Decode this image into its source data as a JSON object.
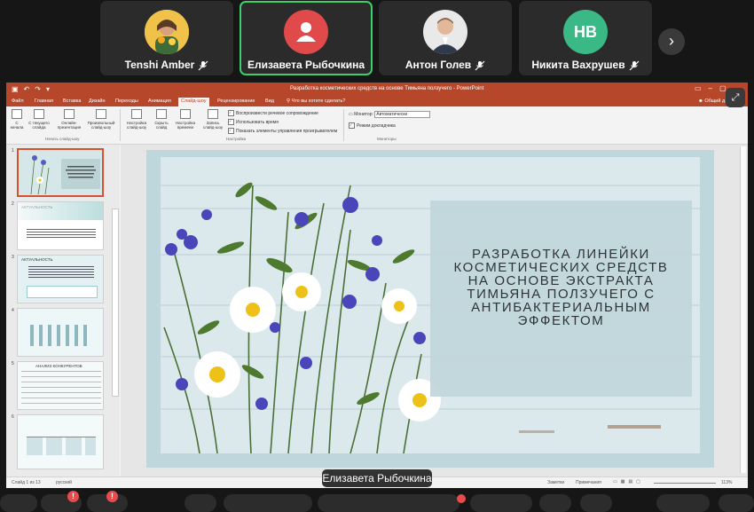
{
  "participants": [
    {
      "name": "Tenshi Amber",
      "muted": true,
      "avatar": "photo"
    },
    {
      "name": "Елизавета Рыбочкина",
      "muted": false,
      "avatar": "user-icon",
      "avatar_color": "#e14a4a",
      "speaking": true
    },
    {
      "name": "Антон Голев",
      "muted": true,
      "avatar": "photo"
    },
    {
      "name": "Никита Вахрушев",
      "muted": true,
      "avatar": "initials",
      "initials": "НВ",
      "avatar_color": "#3ab886"
    }
  ],
  "next_page_icon": "›",
  "expand_icon": "⤢",
  "speaker_label": "Елизавета Рыбочкина",
  "powerpoint": {
    "document_title": "Разработка косметических средств на основе Тимьяна ползучего - PowerPoint",
    "user": "Общий д",
    "tabs": [
      "Файл",
      "Главная",
      "Вставка",
      "Дизайн",
      "Переходы",
      "Анимация",
      "Слайд-шоу",
      "Рецензирование",
      "Вид"
    ],
    "selected_tab": "Слайд-шоу",
    "tell_me": "Что вы хотите сделать?",
    "share_label": "Общий д",
    "ribbon": {
      "buttons": [
        {
          "label": "С начала"
        },
        {
          "label": "С текущего слайда"
        },
        {
          "label": "Онлайн-презентация"
        },
        {
          "label": "Произвольный слайд-шоу"
        },
        {
          "label": "Настройка слайд-шоу"
        },
        {
          "label": "Скрыть слайд"
        },
        {
          "label": "Настройка времени"
        },
        {
          "label": "Запись слайд-шоу"
        }
      ],
      "group_start": "Начать слайд-шоу",
      "group_setup": "Настройка",
      "group_monitors": "Мониторы",
      "checkboxes": [
        "Воспроизвести речевое сопровождение",
        "Использовать время",
        "Показать элементы управления проигрывателем"
      ],
      "monitor_label": "Монитор:",
      "monitor_value": "Автоматически",
      "presenter_view": "Режим докладчика"
    },
    "thumbnails": [
      "1",
      "2",
      "3",
      "4",
      "5",
      "6"
    ],
    "thumbnail_texts": {
      "t2": "АКТУАЛЬНОСТЬ",
      "t3": "АКТУАЛЬНОСТЬ",
      "t5": "АНАЛИЗ КОНКУРЕНТОВ"
    },
    "slide_title": "РАЗРАБОТКА ЛИНЕЙКИ\nКОСМЕТИЧЕСКИХ СРЕДСТВ\nНА ОСНОВЕ ЭКСТРАКТА\nТИМЬЯНА ПОЛЗУЧЕГО С\nАНТИБАКТЕРИАЛЬНЫМ\nЭФФЕКТОМ",
    "status": {
      "slide_counter": "Слайд 1 из 13",
      "language": "русский",
      "notes": "Заметки",
      "comments": "Примечания",
      "zoom": "113%"
    }
  },
  "colors": {
    "accent_green": "#3ccf6c",
    "powerpoint_red": "#b7472a",
    "mute_red": "#e74b4b"
  }
}
